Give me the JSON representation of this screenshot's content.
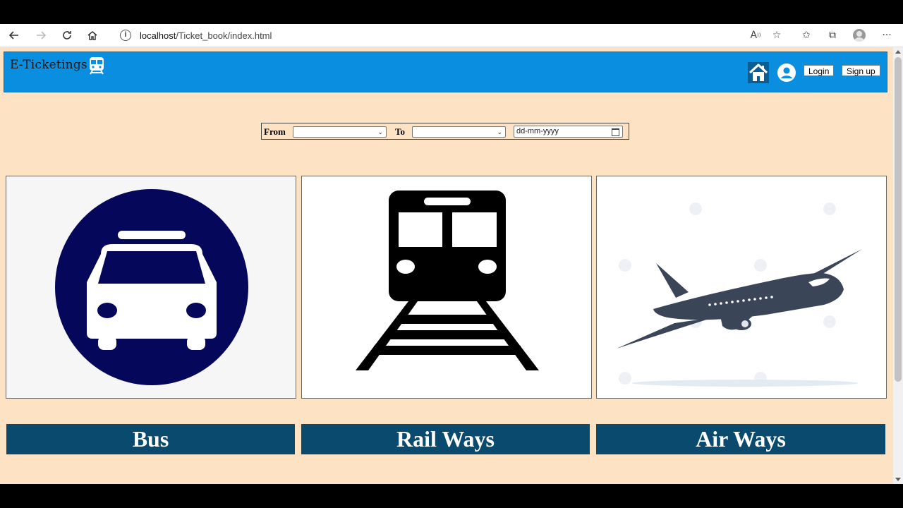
{
  "browser": {
    "url_host": "localhost",
    "url_path": "/Ticket_book/index.html"
  },
  "header": {
    "brand": "E-Ticketings",
    "login_label": "Login",
    "signup_label": "Sign up",
    "bg_color": "#0a8ee0"
  },
  "search": {
    "from_label": "From",
    "to_label": "To",
    "from_value": "",
    "to_value": "",
    "date_placeholder": "dd-mm-yyyy"
  },
  "modes": [
    {
      "label": "Bus",
      "icon": "bus-icon"
    },
    {
      "label": "Rail Ways",
      "icon": "train-icon"
    },
    {
      "label": "Air Ways",
      "icon": "airplane-icon"
    }
  ],
  "colors": {
    "page_bg": "#fde3c4",
    "label_bar": "#0b4a6f",
    "bus_circle": "#05085a",
    "plane": "#3b4558"
  }
}
